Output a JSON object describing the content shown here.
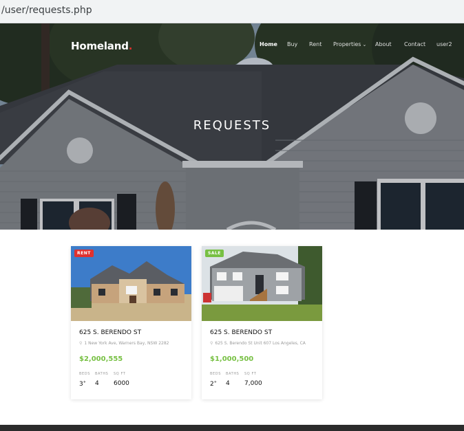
{
  "browser": {
    "url": "/user/requests.php"
  },
  "site": {
    "logo": "Homeland",
    "logo_dot": ".",
    "nav": [
      {
        "label": "Home",
        "active": true
      },
      {
        "label": "Buy"
      },
      {
        "label": "Rent"
      },
      {
        "label": "Properties",
        "dropdown": true
      },
      {
        "label": "About"
      },
      {
        "label": "Contact"
      },
      {
        "label": "user2"
      }
    ],
    "nav_dropdown_icon": "chevron-down-icon"
  },
  "hero": {
    "title": "REQUESTS"
  },
  "listings": [
    {
      "badge": "RENT",
      "badge_color": "#e0312e",
      "title": "625 S. BERENDO ST",
      "address": "1 New York Ave, Warners Bay, NSW 2282",
      "price": "$2,000,555",
      "specs": [
        {
          "label": "BEDS",
          "value": "3",
          "suffix": "+"
        },
        {
          "label": "BATHS",
          "value": "4"
        },
        {
          "label": "SQ FT",
          "value": "6000"
        }
      ]
    },
    {
      "badge": "SALE",
      "badge_color": "#77c043",
      "title": "625 S. BERENDO ST",
      "address": "625 S. Berendo St Unit 607 Los Angeles, CA",
      "price": "$1,000,500",
      "specs": [
        {
          "label": "BEDS",
          "value": "2",
          "suffix": "+"
        },
        {
          "label": "BATHS",
          "value": "4"
        },
        {
          "label": "SQ FT",
          "value": "7,000"
        }
      ]
    }
  ],
  "colors": {
    "accent_green": "#77c043",
    "accent_red": "#e0312e",
    "footer": "#2b2b2b"
  }
}
